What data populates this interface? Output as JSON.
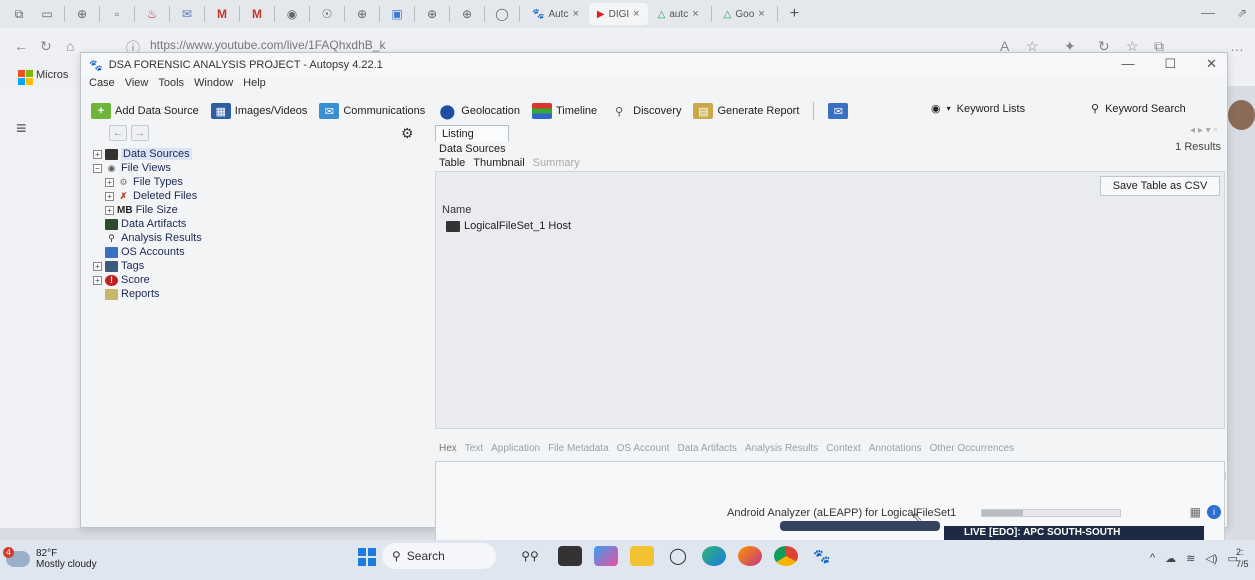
{
  "browser": {
    "tabs": [
      {
        "label": "Autc",
        "close": "×"
      },
      {
        "label": "DIGI",
        "close": "×"
      },
      {
        "label": "autc",
        "close": "×"
      },
      {
        "label": "Goo",
        "close": "×"
      }
    ],
    "new_tab": "+",
    "url": "https://www.youtube.com/live/1FAQhxdhB_k",
    "favorites_label": "Micros"
  },
  "app": {
    "title": "DSA FORENSIC ANALYSIS PROJECT - Autopsy 4.22.1",
    "menu": [
      "Case",
      "View",
      "Tools",
      "Window",
      "Help"
    ],
    "toolbar": {
      "add_data_source": "Add Data Source",
      "images_videos": "Images/Videos",
      "communications": "Communications",
      "geolocation": "Geolocation",
      "timeline": "Timeline",
      "discovery": "Discovery",
      "generate_report": "Generate Report",
      "keyword_lists": "Keyword Lists",
      "keyword_search": "Keyword Search"
    },
    "tree": [
      {
        "label": "Data Sources",
        "level": 0,
        "expand": "+",
        "selected": true
      },
      {
        "label": "File Views",
        "level": 0,
        "expand": "−"
      },
      {
        "label": "File Types",
        "level": 1,
        "expand": "+"
      },
      {
        "label": "Deleted Files",
        "level": 1,
        "expand": "+"
      },
      {
        "label": "File Size",
        "level": 1,
        "expand": "+",
        "icon_text": "MB"
      },
      {
        "label": "Data Artifacts",
        "level": 0,
        "expand": ""
      },
      {
        "label": "Analysis Results",
        "level": 0,
        "expand": ""
      },
      {
        "label": "OS Accounts",
        "level": 0,
        "expand": ""
      },
      {
        "label": "Tags",
        "level": 0,
        "expand": "+"
      },
      {
        "label": "Score",
        "level": 0,
        "expand": "+"
      },
      {
        "label": "Reports",
        "level": 0,
        "expand": ""
      }
    ],
    "listing": {
      "tab": "Listing",
      "breadcrumb": "Data Sources",
      "results": "1  Results",
      "subtabs": [
        "Table",
        "Thumbnail",
        "Summary"
      ],
      "save_csv": "Save Table as CSV",
      "column_header": "Name",
      "rows": [
        "LogicalFileSet_1 Host"
      ]
    },
    "content_tabs": [
      "Hex",
      "Text",
      "Application",
      "File Metadata",
      "OS Account",
      "Data Artifacts",
      "Analysis Results",
      "Context",
      "Annotations",
      "Other Occurrences"
    ],
    "status": "Android Analyzer (aLEAPP) for LogicalFileSet1",
    "progress": 0.3
  },
  "live_banner": "LIVE [EDO]: APC SOUTH-SOUTH",
  "taskbar": {
    "weather_temp": "82°F",
    "weather_desc": "Mostly cloudy",
    "weather_badge": "4",
    "search_placeholder": "Search",
    "clock_time": "2:",
    "clock_date": "7/5"
  }
}
